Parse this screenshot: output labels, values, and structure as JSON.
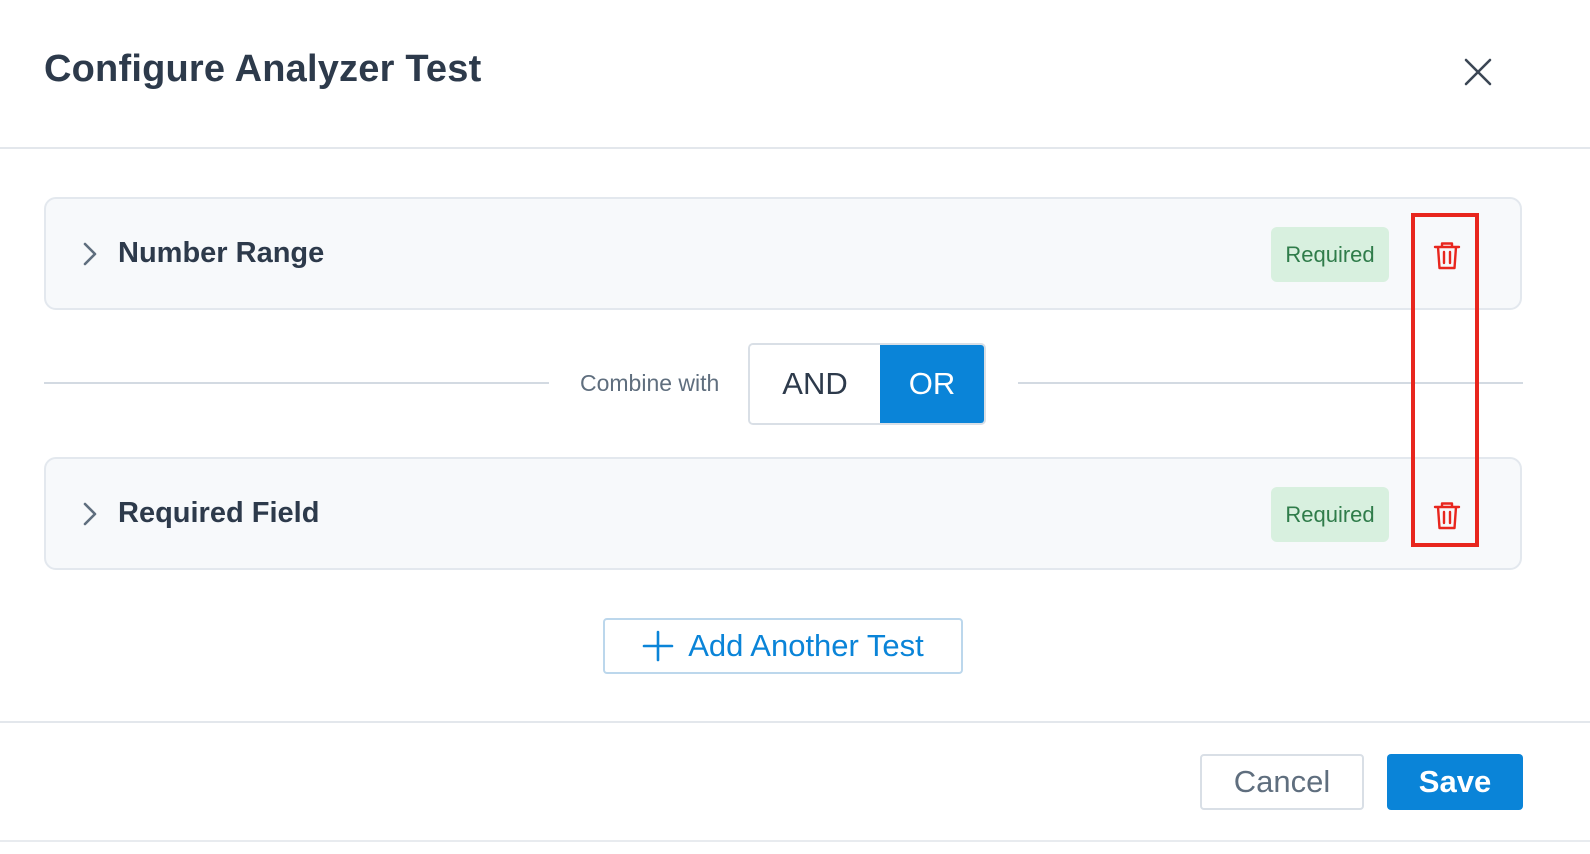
{
  "dialog": {
    "title": "Configure Analyzer Test"
  },
  "tests": [
    {
      "name": "Number Range",
      "badge": "Required"
    },
    {
      "name": "Required Field",
      "badge": "Required"
    }
  ],
  "combine": {
    "label": "Combine with",
    "options": [
      "AND",
      "OR"
    ],
    "selected": "OR"
  },
  "add_test_label": "Add Another Test",
  "footer": {
    "cancel_label": "Cancel",
    "save_label": "Save"
  },
  "colors": {
    "accent": "#0a84d8",
    "danger": "#e8261e",
    "badge_bg": "#d8f0df",
    "badge_text": "#2f7c4a"
  },
  "icons": {
    "close": "close-icon",
    "expand": "chevron-right-icon",
    "delete": "trash-icon",
    "add": "plus-icon"
  }
}
